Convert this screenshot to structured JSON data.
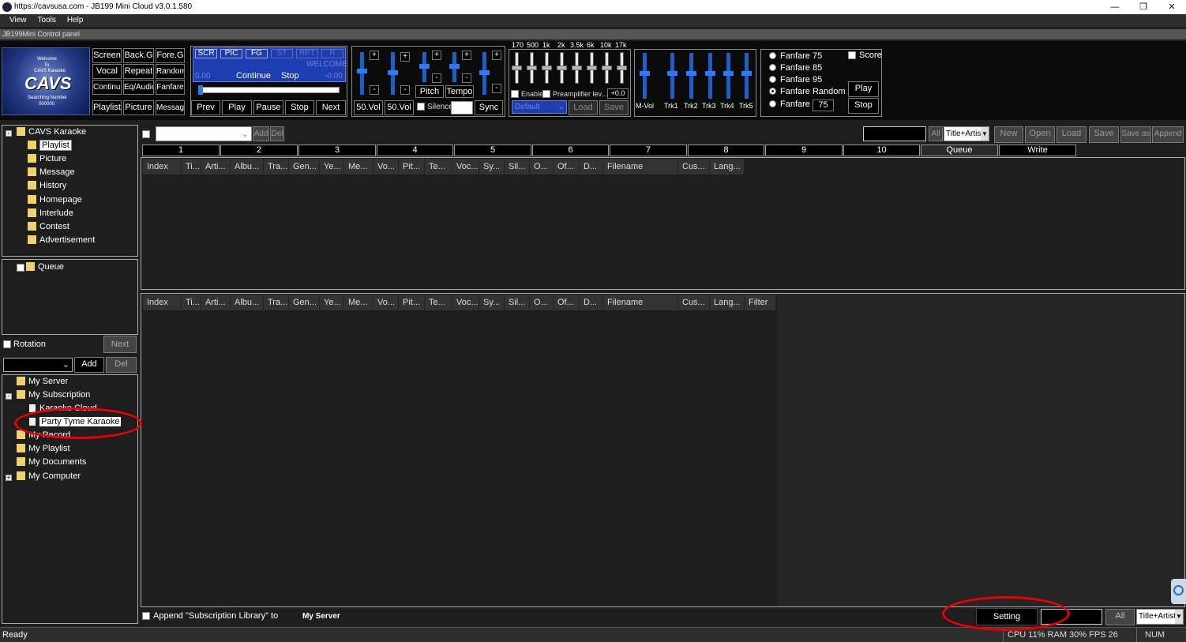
{
  "window": {
    "title": "https://cavsusa.com - JB199 Mini Cloud v3.0.1.580",
    "min": "—",
    "restore": "❐",
    "close": "✕"
  },
  "menu": [
    "View",
    "Tools",
    "Help"
  ],
  "control_panel_label": "JB199Mini Control panel",
  "logo": {
    "line1": "Welcome",
    "line2": "To",
    "line3": "CAVS Karaoke",
    "line4": "Searching Number",
    "line5": "000000",
    "brand": "CAVS"
  },
  "grid_buttons": [
    "Screen",
    "Back.G",
    "Fore.G",
    "Vocal",
    "Repeat",
    "Random",
    "Continue",
    "Eq/Audio",
    "Fanfare",
    "Playlist",
    "Picture",
    "Message"
  ],
  "mini_display": {
    "tags": [
      "SCR",
      "PIC",
      "FG",
      "ST",
      "RPT",
      "R"
    ],
    "welcome": "WELCOME",
    "time_left": "0.00",
    "continue": "Continue",
    "stop": "Stop",
    "time_right": "-0.00"
  },
  "transport": [
    "Prev",
    "Play",
    "Pause",
    "Stop",
    "Next"
  ],
  "vol": {
    "left": "50.Vol",
    "right": "50.Vol",
    "pitch": "Pitch",
    "tempo": "Tempo",
    "silence": "Silence",
    "sync": "Sync",
    "plus": "+",
    "minus": "-"
  },
  "eq": {
    "freqs": [
      "170",
      "500",
      "1k",
      "2k",
      "3.5k",
      "6k",
      "10k",
      "17k"
    ],
    "enable": "Enable",
    "preamp": "Preamplifier lev...",
    "preamp_val": "+0.0",
    "preset": "Default",
    "load": "Load",
    "save": "Save"
  },
  "mixer": {
    "labels": [
      "M-Vol",
      "Trk1",
      "Trk2",
      "Trk3",
      "Trk4",
      "Trk5"
    ]
  },
  "fanfare": {
    "options": [
      "Fanfare 75",
      "Fanfare 85",
      "Fanfare 95",
      "Fanfare Random",
      "Fanfare"
    ],
    "custom_val": "75",
    "score": "Score",
    "play": "Play",
    "stop": "Stop"
  },
  "tree1": {
    "root": "CAVS Karaoke",
    "items": [
      "Playlist",
      "Picture",
      "Message",
      "History",
      "Homepage",
      "Interlude",
      "Contest",
      "Advertisement"
    ]
  },
  "queue_tree": {
    "item": "Queue"
  },
  "rotation": {
    "label": "Rotation",
    "next": "Next"
  },
  "add_del": {
    "add": "Add",
    "del": "Del"
  },
  "tree2": {
    "items": [
      "My Server",
      "My Subscription",
      "Karaoke Cloud",
      "Party Tyme Karaoke",
      "My Record",
      "My Playlist",
      "My Documents",
      "My Computer"
    ]
  },
  "toolbar": {
    "add": "Add",
    "del": "Del",
    "all": "All",
    "mode": "Title+Artist",
    "new": "New",
    "open": "Open",
    "load": "Load",
    "save": "Save",
    "save_as": "Save as",
    "append": "Append"
  },
  "tabs": [
    "1",
    "2",
    "3",
    "4",
    "5",
    "6",
    "7",
    "8",
    "9",
    "10",
    "Queue",
    "Write"
  ],
  "columns_top": [
    "Index",
    "Ti...",
    "Arti...",
    "Albu...",
    "Tra...",
    "Gen...",
    "Ye...",
    "Me...",
    "Vo...",
    "Pit...",
    "Te...",
    "Voc...",
    "Sy...",
    "Sil...",
    "O...",
    "Of...",
    "D...",
    "Filename",
    "Cus...",
    "Lang..."
  ],
  "columns_bottom": [
    "Index",
    "Ti...",
    "Arti...",
    "Albu...",
    "Tra...",
    "Gen...",
    "Ye...",
    "Me...",
    "Vo...",
    "Pit...",
    "Te...",
    "Voc...",
    "Sy...",
    "Sil...",
    "O...",
    "Of...",
    "D...",
    "Filename",
    "Cus...",
    "Lang...",
    "Filter"
  ],
  "bottom_bar": {
    "append_label": "Append \"Subscription Library\" to",
    "target": "My Server",
    "setting": "Setting",
    "all": "All",
    "mode": "Title+Artist"
  },
  "status": {
    "ready": "Ready",
    "perf": "CPU 11% RAM 30% FPS 26",
    "num": "NUM"
  }
}
